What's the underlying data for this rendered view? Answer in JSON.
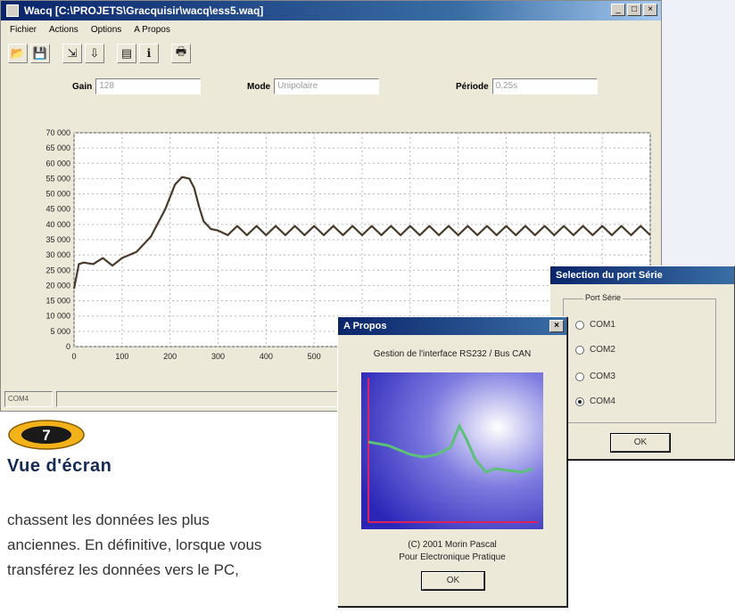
{
  "main_window": {
    "title": "Wacq [C:\\PROJETS\\Gracquisir\\wacq\\ess5.waq]",
    "menu": [
      "Fichier",
      "Actions",
      "Options",
      "A Propos"
    ],
    "fields": [
      {
        "label": "Gain",
        "value": "128"
      },
      {
        "label": "Mode",
        "value": "Unipolaire"
      },
      {
        "label": "Période",
        "value": "0.25s"
      }
    ],
    "status": [
      "COM4",
      ""
    ]
  },
  "chart_data": {
    "type": "line",
    "title": "",
    "xlabel": "",
    "ylabel": "",
    "xlim": [
      0,
      1200
    ],
    "ylim": [
      0,
      70000
    ],
    "x_ticks": [
      0,
      100,
      200,
      300,
      400,
      500
    ],
    "y_ticks": [
      "0",
      "5 000",
      "10 000",
      "15 000",
      "20 000",
      "25 000",
      "30 000",
      "35 000",
      "40 000",
      "45 000",
      "50 000",
      "55 000",
      "60 000",
      "65 000",
      "70 000"
    ],
    "grid": true,
    "series": [
      {
        "color": "#4a3a2a",
        "x": [
          0,
          10,
          20,
          40,
          60,
          80,
          100,
          130,
          160,
          190,
          210,
          225,
          240,
          250,
          260,
          270,
          285,
          300,
          320,
          340,
          360,
          380,
          400,
          420,
          440,
          460,
          480,
          500,
          520,
          540,
          560,
          580,
          600,
          620,
          640,
          660,
          680,
          700,
          720,
          740,
          760,
          780,
          800,
          820,
          840,
          860,
          880,
          900,
          920,
          940,
          960,
          980,
          1000,
          1020,
          1040,
          1060,
          1080,
          1100,
          1120,
          1140,
          1160,
          1180,
          1200
        ],
        "y": [
          19000,
          27000,
          27500,
          27000,
          29000,
          26500,
          29000,
          31000,
          36000,
          45000,
          53000,
          55500,
          55000,
          52000,
          46000,
          41000,
          38500,
          38000,
          36500,
          39500,
          36500,
          39500,
          36500,
          39500,
          36500,
          39500,
          36500,
          39500,
          36500,
          39500,
          36500,
          39500,
          36500,
          39500,
          36500,
          39500,
          36500,
          39500,
          36500,
          39500,
          36500,
          39500,
          36500,
          39500,
          36500,
          39500,
          36500,
          39500,
          36500,
          39500,
          36500,
          39500,
          36500,
          39500,
          36500,
          39500,
          36500,
          39500,
          36500,
          39500,
          36500,
          39500,
          36500
        ]
      }
    ]
  },
  "badge": {
    "number": "7"
  },
  "heading": "Vue d'écran",
  "body_lines": [
    "chassent les données les plus",
    "anciennes. En définitive, lorsque vous",
    "transférez les données vers le PC,"
  ],
  "port_dialog": {
    "title": "Selection du port Série",
    "group_label": "Port Série",
    "ports": [
      {
        "label": "COM1",
        "checked": false
      },
      {
        "label": "COM2",
        "checked": false
      },
      {
        "label": "COM3",
        "checked": false
      },
      {
        "label": "COM4",
        "checked": true
      }
    ],
    "ok_label": "OK"
  },
  "about_dialog": {
    "title": "A Propos",
    "subtitle": "Gestion de l'interface RS232 / Bus CAN",
    "copyright": "(C) 2001 Morin Pascal",
    "credit": "Pour Electronique Pratique",
    "ok_label": "OK"
  },
  "colors": {
    "titlebar": "#0a246a",
    "window_bg": "#ece9d8",
    "curve": "#4a3a2a",
    "heading": "#142a52",
    "badge": "#f3b21a"
  }
}
